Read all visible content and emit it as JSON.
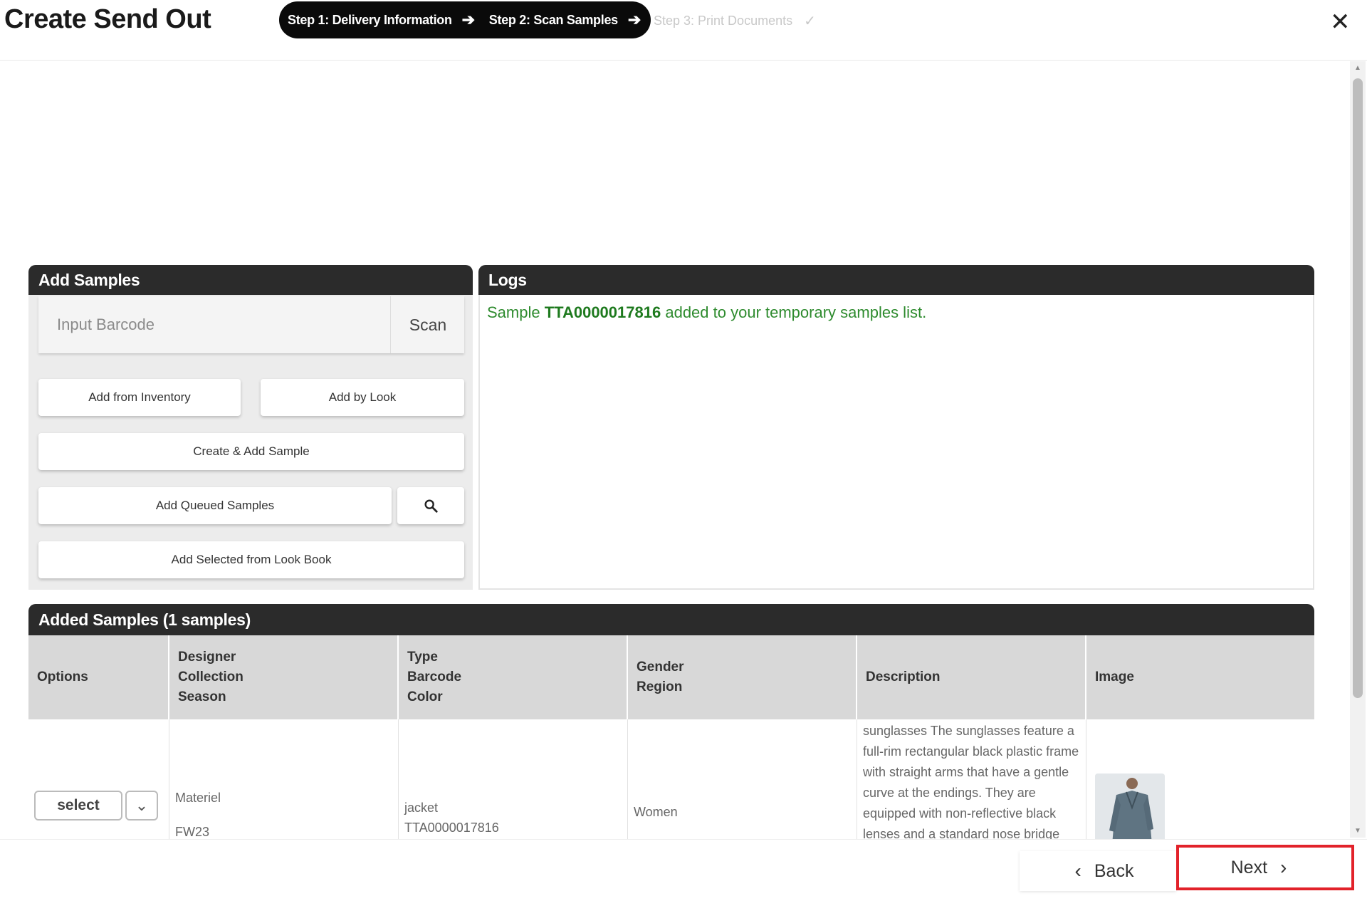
{
  "header": {
    "title": "Create Send Out",
    "steps": [
      {
        "label": "Step 1: Delivery Information",
        "state": "done"
      },
      {
        "label": "Step 2: Scan Samples",
        "state": "active"
      },
      {
        "label": "Step 3: Print Documents",
        "state": "pending"
      }
    ]
  },
  "add_samples": {
    "title": "Add Samples",
    "barcode_placeholder": "Input Barcode",
    "scan_label": "Scan",
    "buttons": {
      "add_from_inventory": "Add from Inventory",
      "add_by_look": "Add by Look",
      "create_add_sample": "Create & Add Sample",
      "add_queued_samples": "Add Queued Samples",
      "add_selected_lookbook": "Add Selected from Look Book"
    }
  },
  "logs": {
    "title": "Logs",
    "entries": [
      {
        "prefix": "Sample",
        "code": "TTA0000017816",
        "suffix": "added to your temporary samples list."
      }
    ]
  },
  "added_samples": {
    "title": "Added Samples (1 samples)",
    "columns": {
      "options": [
        "Options"
      ],
      "designer": [
        "Designer",
        "Collection",
        "Season"
      ],
      "type": [
        "Type",
        "Barcode",
        "Color"
      ],
      "gender": [
        "Gender",
        "Region"
      ],
      "description": [
        "Description"
      ],
      "image": [
        "Image"
      ]
    },
    "rows": [
      {
        "select_label": "select",
        "designer": "Materiel",
        "season": "FW23",
        "type": "jacket",
        "barcode": "TTA0000017816",
        "gender": "Women",
        "description": "sunglasses The sunglasses feature a full-rim rectangular black plastic frame with straight arms that have a gentle curve at the endings. They are equipped with non-reflective black lenses and a standard nose bridge"
      }
    ]
  },
  "footer": {
    "back_label": "Back",
    "next_label": "Next"
  },
  "colors": {
    "accent_dark": "#0a0a0a",
    "log_green": "#2e8b2e",
    "highlight_red": "#e2222a"
  }
}
